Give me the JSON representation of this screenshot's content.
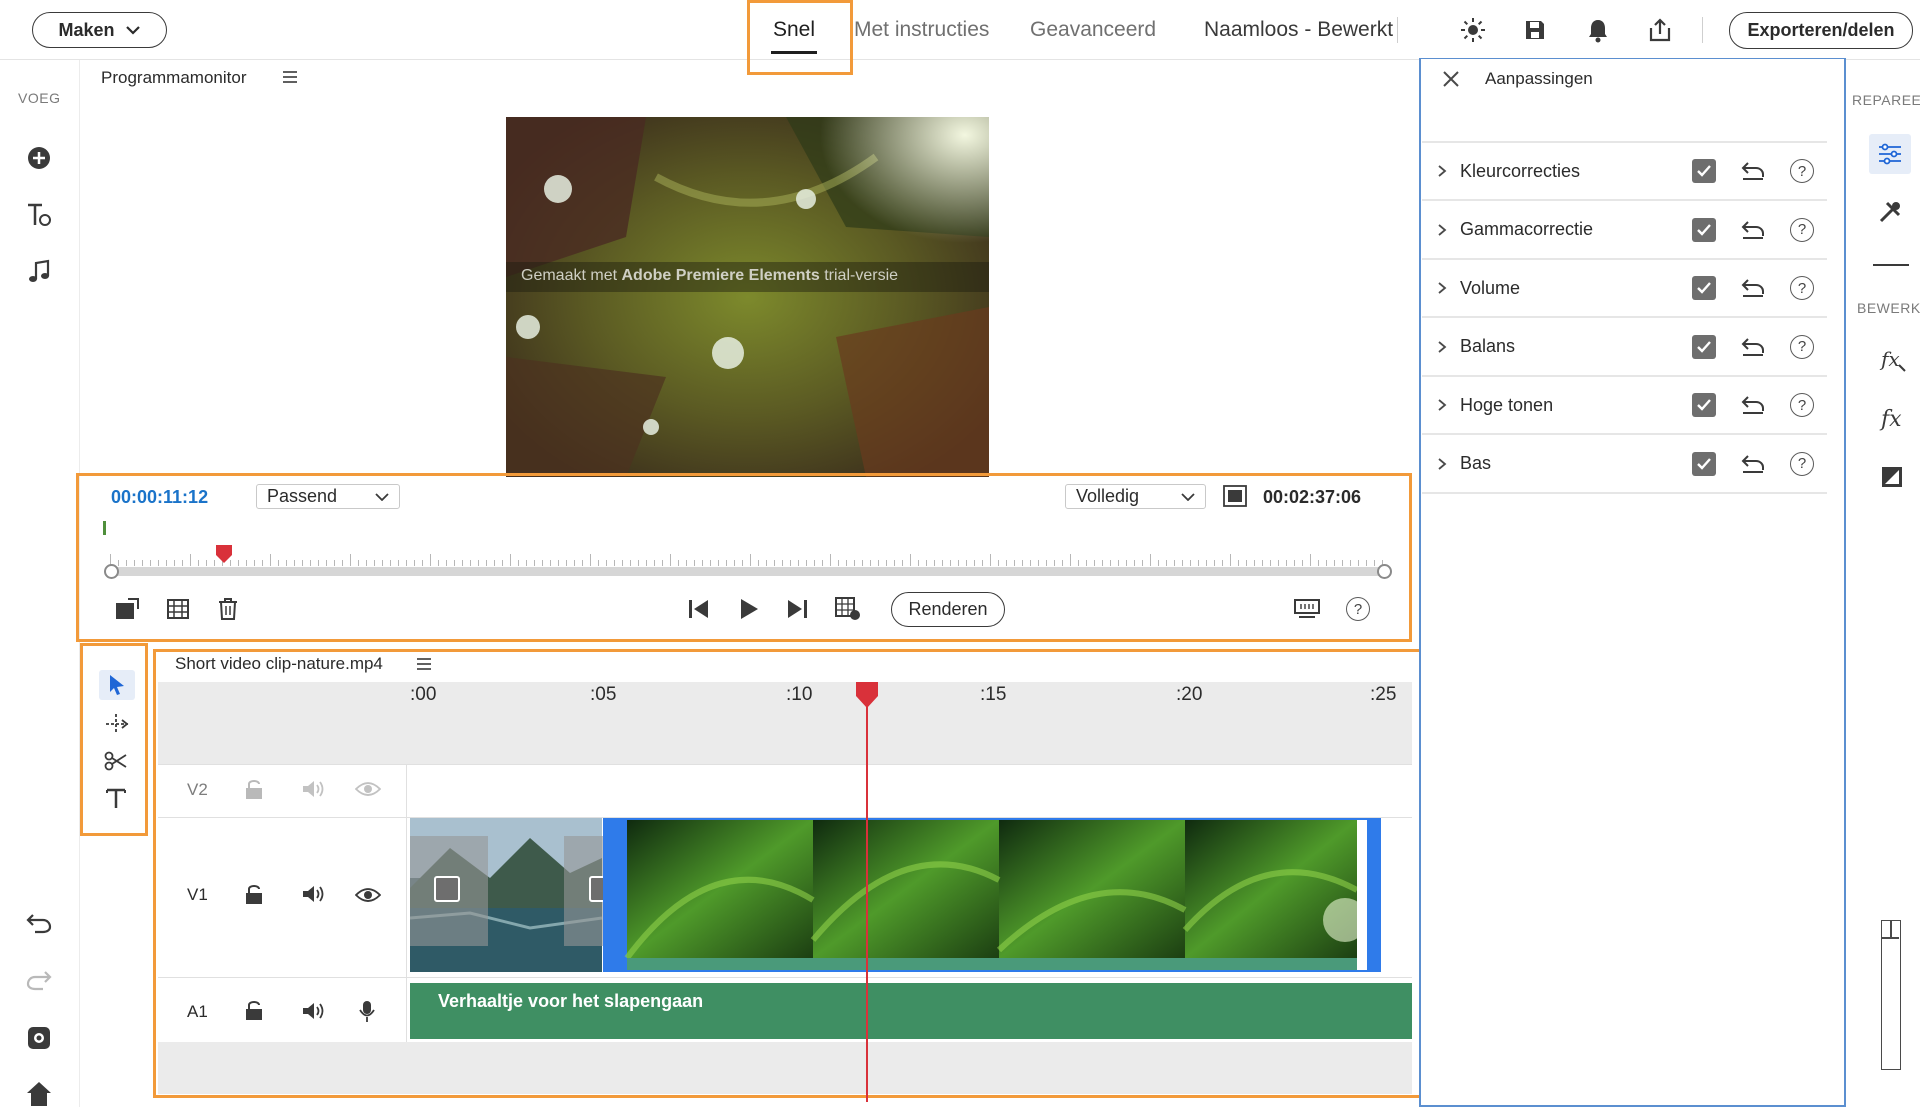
{
  "topbar": {
    "create_label": "Maken",
    "tabs": [
      "Snel",
      "Met instructies",
      "Geavanceerd"
    ],
    "project_title": "Naamloos - Bewerkt",
    "export_label": "Exporteren/delen"
  },
  "leftbar": {
    "section_label": "VOEG"
  },
  "monitor": {
    "title": "Programmamonitor",
    "watermark_prefix": "Gemaakt met ",
    "watermark_brand": "Adobe Premiere Elements",
    "watermark_suffix": " trial-versie",
    "current_time": "00:00:11:12",
    "fit_select": "Passend",
    "quality_select": "Volledig",
    "total_time": "00:02:37:06",
    "render_label": "Renderen",
    "scrub_progress": 0.089
  },
  "timeline": {
    "clip_name": "Short video clip-nature.mp4",
    "ruler_labels": [
      ":00",
      ":05",
      ":10",
      ":15",
      ":20",
      ":25"
    ],
    "tracks": {
      "v2": "V2",
      "v1": "V1",
      "a1": "A1"
    },
    "audio_clip_label": "Verhaaltje voor het slapengaan",
    "playhead_seconds": 11.5
  },
  "adjustments": {
    "title": "Aanpassingen",
    "items": [
      {
        "label": "Kleurcorrecties",
        "checked": true
      },
      {
        "label": "Gammacorrectie",
        "checked": true
      },
      {
        "label": "Volume",
        "checked": true
      },
      {
        "label": "Balans",
        "checked": true
      },
      {
        "label": "Hoge tonen",
        "checked": true
      },
      {
        "label": "Bas",
        "checked": true
      }
    ]
  },
  "rightbar": {
    "repair_label": "REPAREEI",
    "edit_label": "BEWERK"
  },
  "colors": {
    "accent_orange": "#f29a3a",
    "time_blue": "#1a73c9",
    "playhead_red": "#d9313a",
    "audio_green": "#3f8f63",
    "clip_blue": "#2f7bea"
  }
}
